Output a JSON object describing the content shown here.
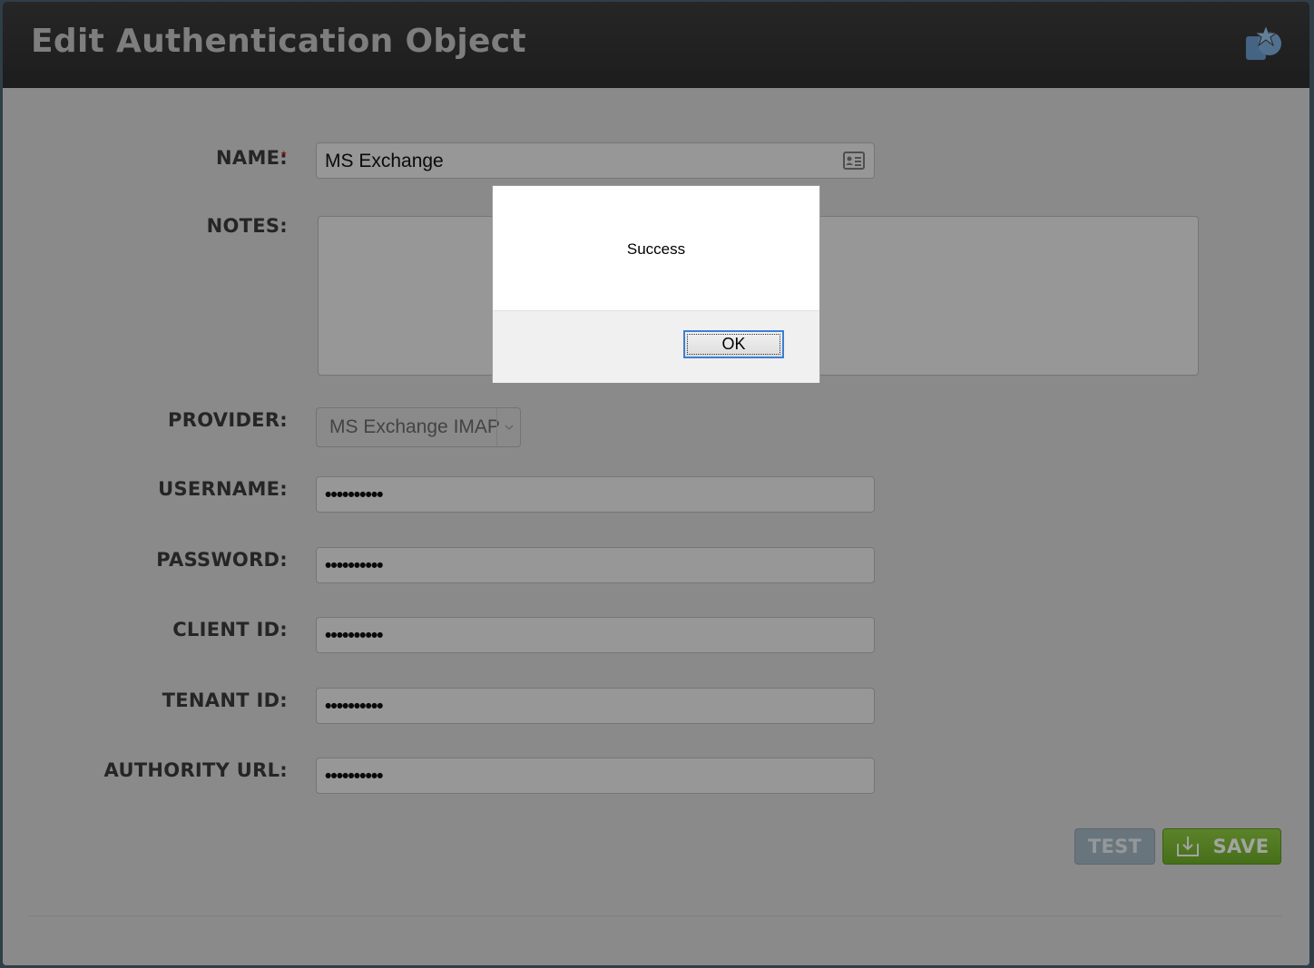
{
  "window": {
    "title": "Edit Authentication Object",
    "logo_icon": "star-badge-icon"
  },
  "form": {
    "name": {
      "label": "NAME:",
      "required_mark": "*",
      "value": "MS Exchange",
      "icon": "contact-card-icon"
    },
    "notes": {
      "label": "NOTES:",
      "value": ""
    },
    "provider": {
      "label": "PROVIDER:",
      "selected": "MS Exchange IMAP"
    },
    "username": {
      "label": "USERNAME:",
      "value": "••••••••••"
    },
    "password": {
      "label": "PASSWORD:",
      "value": "••••••••••"
    },
    "client_id": {
      "label": "CLIENT ID:",
      "value": "••••••••••"
    },
    "tenant_id": {
      "label": "TENANT ID:",
      "value": "••••••••••"
    },
    "authority_url": {
      "label": "AUTHORITY URL:",
      "value": "••••••••••"
    }
  },
  "actions": {
    "test_label": "TEST",
    "save_label": "SAVE",
    "save_icon": "download-tray-icon"
  },
  "dialog": {
    "message": "Success",
    "ok_label": "OK"
  },
  "colors": {
    "titlebar": "#333333",
    "save_button": "#7dbd35",
    "test_button": "#a3b7c3",
    "required": "#d00000"
  }
}
